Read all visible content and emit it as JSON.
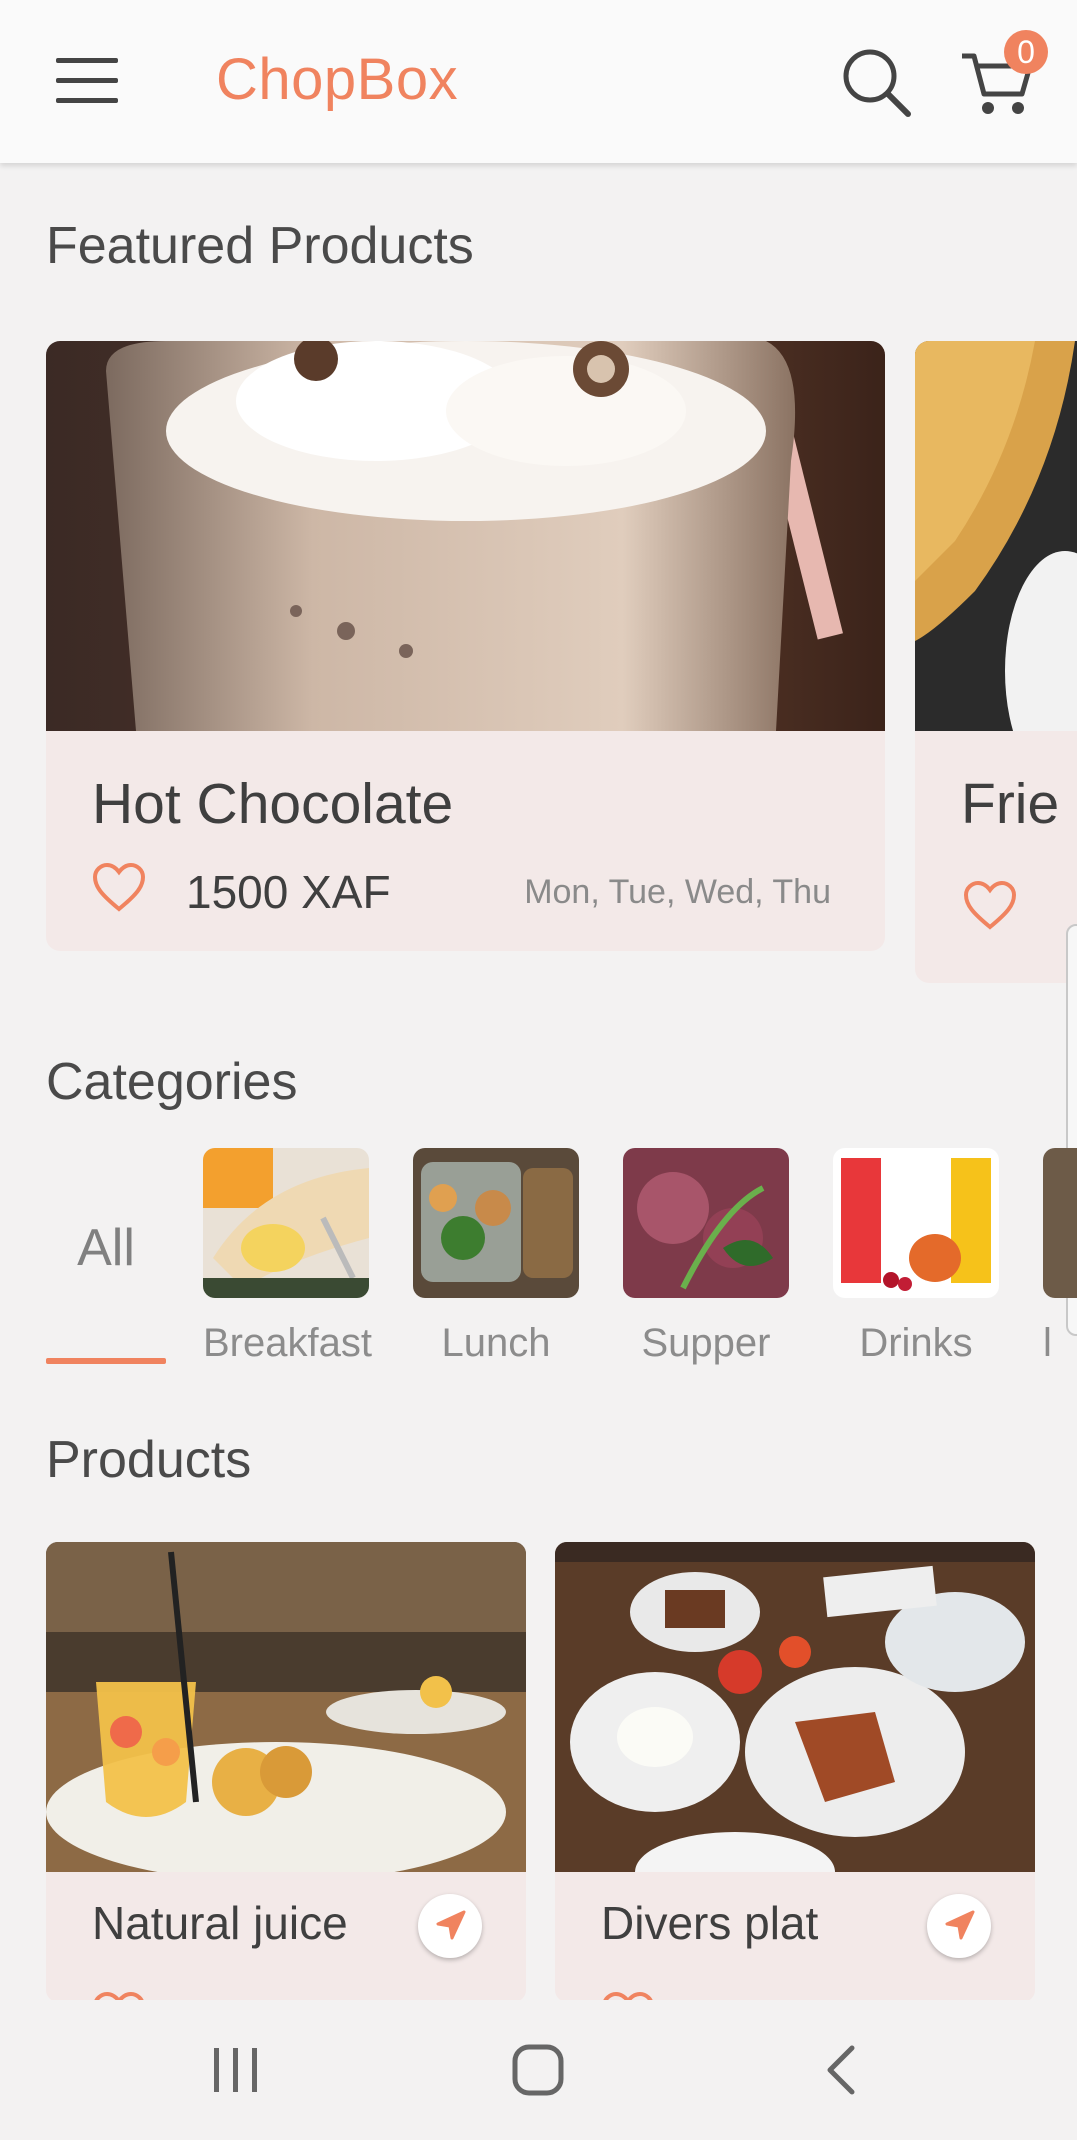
{
  "app": {
    "title": "ChopBox",
    "accent_color": "#f0835f",
    "cart_count": "0"
  },
  "icons": {
    "menu": "menu-icon",
    "search": "search-icon",
    "cart": "cart-icon",
    "heart": "heart-outline-icon",
    "navigate": "navigation-arrow-icon",
    "recents": "recents-icon",
    "home": "home-icon",
    "back": "back-icon"
  },
  "featured": {
    "title": "Featured Products",
    "items": [
      {
        "name": "Hot Chocolate",
        "price": "1500 XAF",
        "days": "Mon, Tue, Wed, Thu"
      },
      {
        "name": "Frie",
        "price": "",
        "days": ""
      }
    ]
  },
  "categories": {
    "title": "Categories",
    "all_label": "All",
    "items": [
      {
        "label": "Breakfast"
      },
      {
        "label": "Lunch"
      },
      {
        "label": "Supper"
      },
      {
        "label": "Drinks"
      },
      {
        "label": "l"
      }
    ]
  },
  "products": {
    "title": "Products",
    "items": [
      {
        "name": "Natural juice"
      },
      {
        "name": "Divers plat"
      }
    ]
  }
}
